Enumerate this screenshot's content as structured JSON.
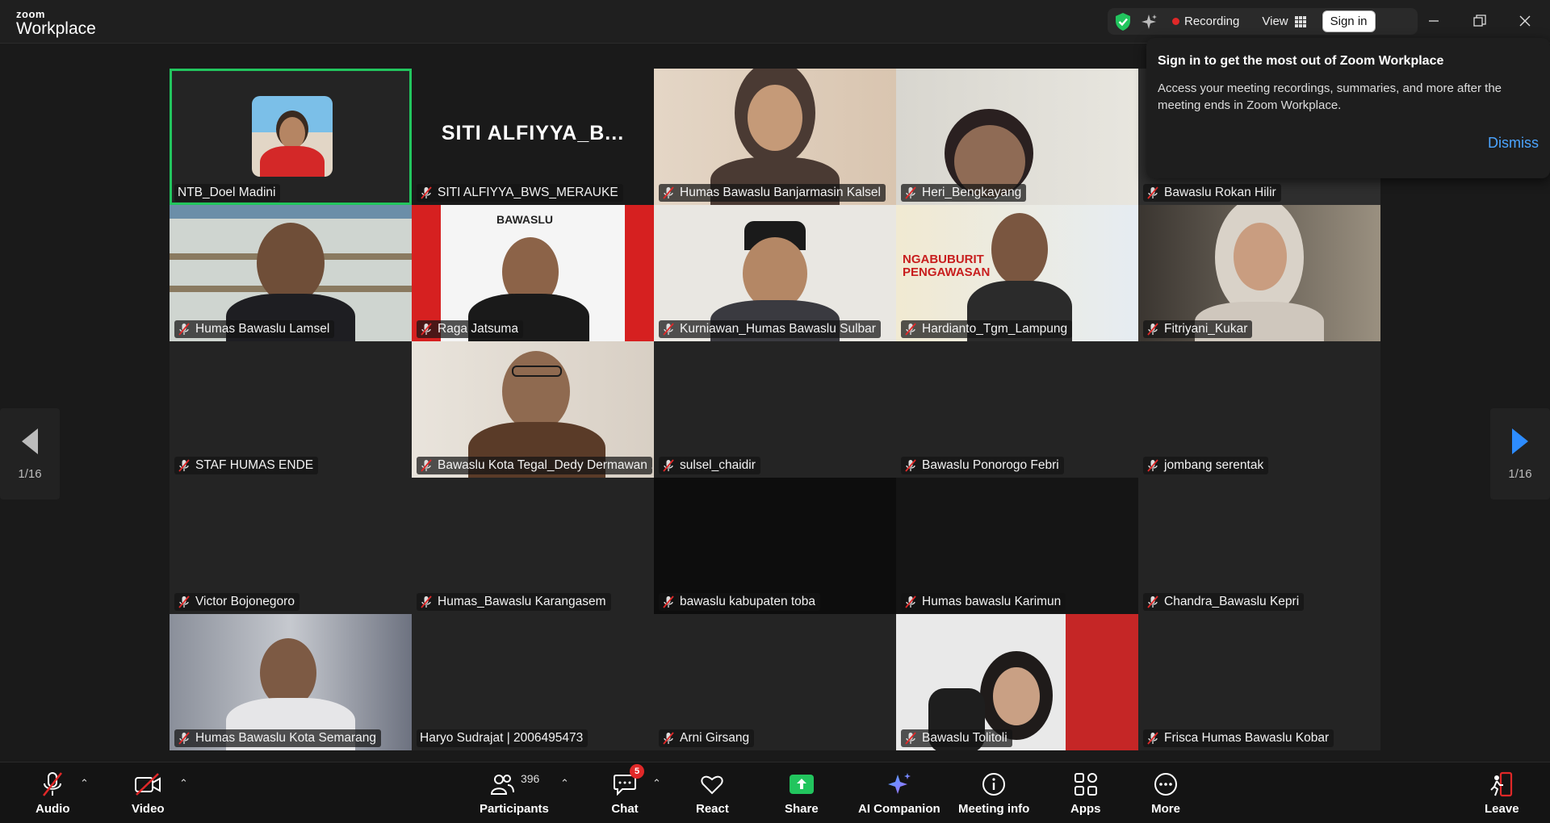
{
  "app": {
    "brand_top": "zoom",
    "brand_bottom": "Workplace"
  },
  "titlebar": {
    "recording": "Recording",
    "view": "View",
    "sign_in": "Sign in"
  },
  "popup": {
    "title": "Sign in to get the most out of Zoom Workplace",
    "body": "Access your meeting recordings, summaries, and more after the meeting ends in Zoom Workplace.",
    "dismiss": "Dismiss"
  },
  "page_indicator": {
    "left": "1/16",
    "right": "1/16"
  },
  "tiles": [
    {
      "name": "NTB_Doel Madini",
      "muted": false
    },
    {
      "name": "SITI ALFIYYA_BWS_MERAUKE",
      "muted": true,
      "center_label": "SITI  ALFIYYA_B..."
    },
    {
      "name": "Humas Bawaslu Banjarmasin Kalsel",
      "muted": true
    },
    {
      "name": "Heri_Bengkayang",
      "muted": true
    },
    {
      "name": "Bawaslu Rokan Hilir",
      "muted": true
    },
    {
      "name": "Humas Bawaslu Lamsel",
      "muted": true
    },
    {
      "name": "Raga Jatsuma",
      "muted": true
    },
    {
      "name": "Kurniawan_Humas Bawaslu Sulbar",
      "muted": true
    },
    {
      "name": "Hardianto_Tgm_Lampung",
      "muted": true
    },
    {
      "name": "Fitriyani_Kukar",
      "muted": true
    },
    {
      "name": "STAF HUMAS ENDE",
      "muted": true
    },
    {
      "name": "Bawaslu Kota Tegal_Dedy Dermawan ...",
      "muted": true
    },
    {
      "name": "sulsel_chaidir",
      "muted": true
    },
    {
      "name": "Bawaslu Ponorogo Febri",
      "muted": true
    },
    {
      "name": "jombang serentak",
      "muted": true
    },
    {
      "name": "Victor Bojonegoro",
      "muted": true
    },
    {
      "name": "Humas_Bawaslu Karangasem",
      "muted": true
    },
    {
      "name": "bawaslu kabupaten toba",
      "muted": true
    },
    {
      "name": "Humas bawaslu Karimun",
      "muted": true
    },
    {
      "name": "Chandra_Bawaslu Kepri",
      "muted": true
    },
    {
      "name": "Humas Bawaslu Kota Semarang",
      "muted": true
    },
    {
      "name": "Haryo Sudrajat  | 2006495473",
      "muted": false
    },
    {
      "name": "Arni Girsang",
      "muted": true
    },
    {
      "name": "Bawaslu Tolitoli",
      "muted": true
    },
    {
      "name": "Frisca Humas Bawaslu Kobar",
      "muted": true
    }
  ],
  "toolbar": {
    "audio": "Audio",
    "video": "Video",
    "participants": "Participants",
    "participants_count": "396",
    "chat": "Chat",
    "chat_badge": "5",
    "react": "React",
    "share": "Share",
    "ai_companion": "AI Companion",
    "meeting_info": "Meeting info",
    "apps": "Apps",
    "more": "More",
    "leave": "Leave"
  },
  "colors": {
    "active_speaker": "#22c55e",
    "share": "#22c55e",
    "accent_link": "#4ba4ff",
    "recording": "#e02828",
    "leave": "#e02828"
  },
  "bawaslu_logo_text": "BAWASLU",
  "banner_text": "NGABUBURIT PENGAWASAN"
}
